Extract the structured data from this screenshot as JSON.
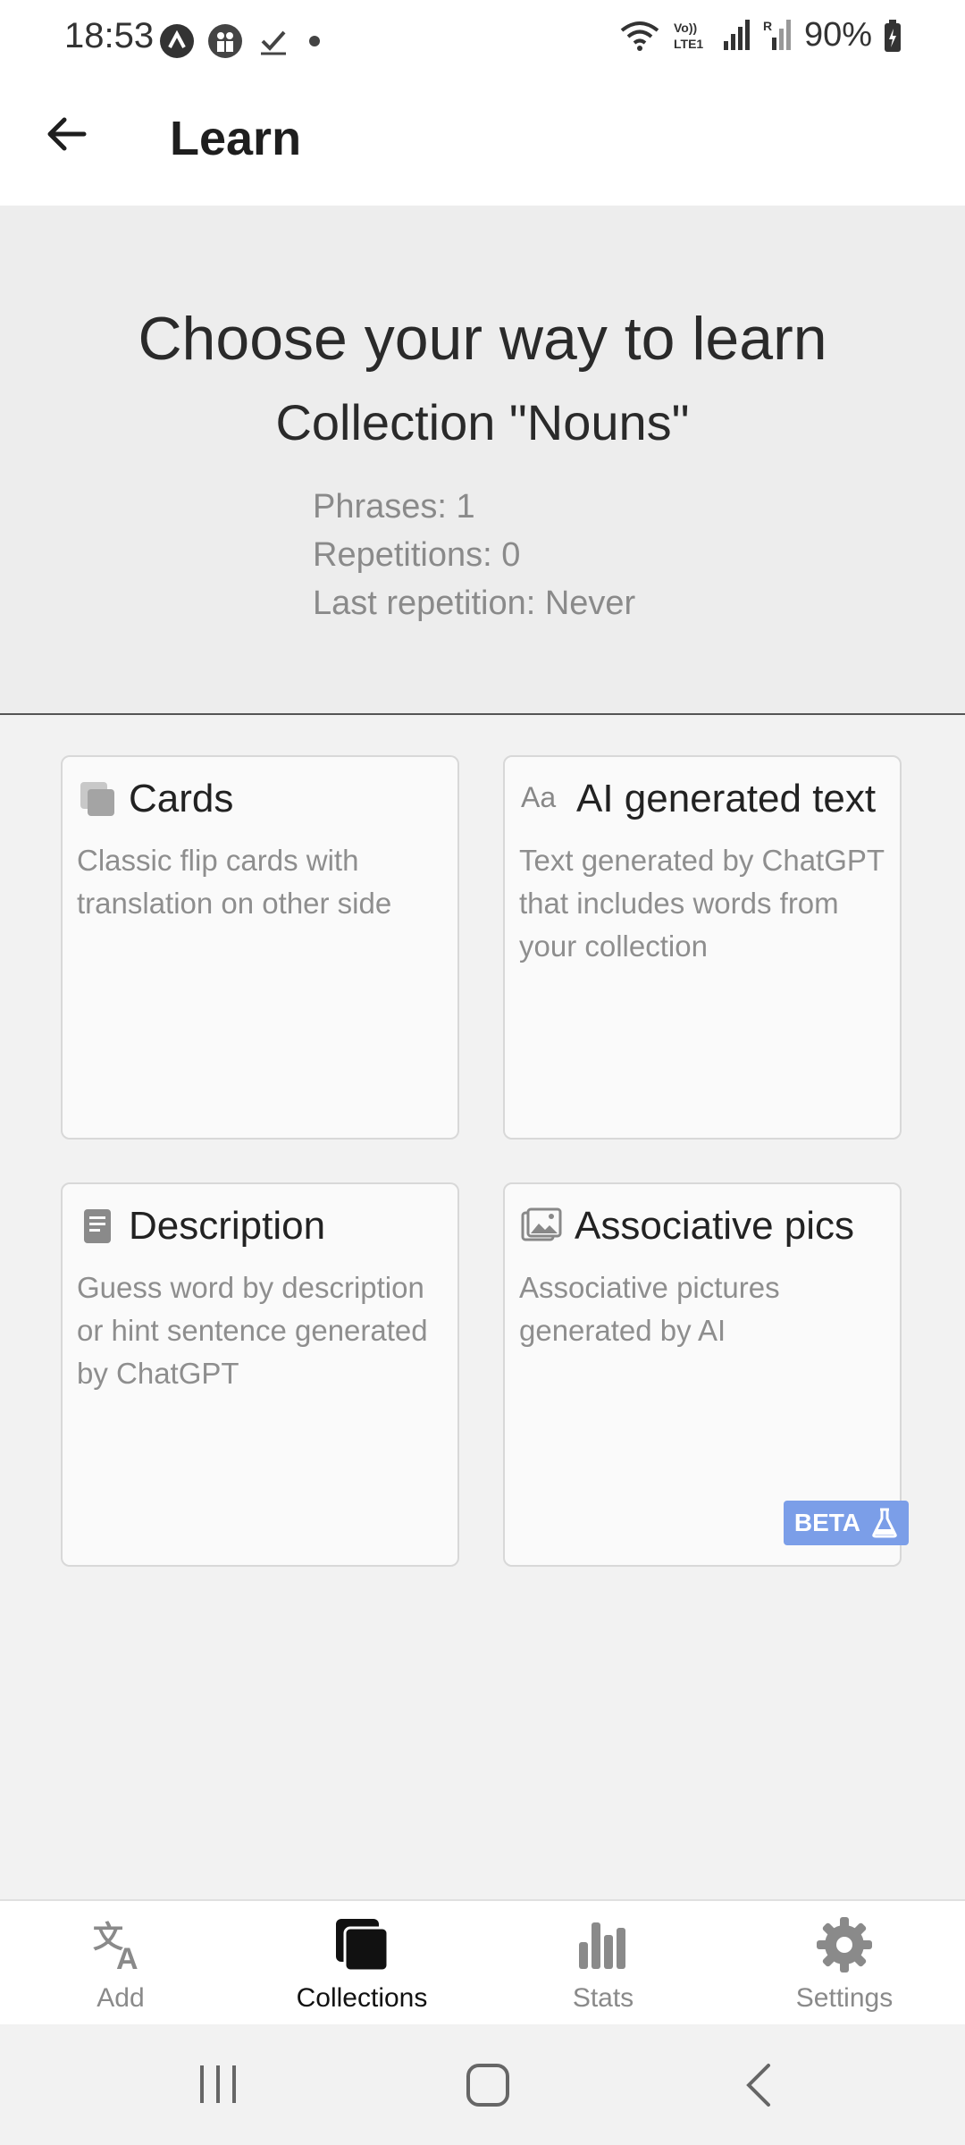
{
  "status": {
    "time": "18:53",
    "battery": "90%",
    "icons": [
      "app-a-icon",
      "users-icon",
      "check-icon",
      "dot-icon",
      "wifi-icon",
      "volte-icon",
      "signal-icon",
      "roaming-signal-icon",
      "battery-icon"
    ]
  },
  "header": {
    "title": "Learn"
  },
  "hero": {
    "title": "Choose your way to learn",
    "collection": "Collection \"Nouns\"",
    "phrases": "Phrases: 1",
    "repetitions": "Repetitions: 0",
    "last_repetition": "Last repetition: Never"
  },
  "cards": [
    {
      "title": "Cards",
      "description": "Classic flip cards with translation on other side",
      "icon": "cards-icon"
    },
    {
      "title": "AI generated text",
      "description": "Text generated by ChatGPT that includes words from your collection",
      "icon": "text-aa-icon"
    },
    {
      "title": "Description",
      "description": "Guess word by description or hint sentence generated by ChatGPT",
      "icon": "document-icon"
    },
    {
      "title": "Associative pics",
      "description": "Associative pictures generated by AI",
      "icon": "image-icon",
      "badge": "BETA"
    }
  ],
  "nav": [
    {
      "label": "Add",
      "icon": "translate-icon",
      "active": false
    },
    {
      "label": "Collections",
      "icon": "collections-icon",
      "active": true
    },
    {
      "label": "Stats",
      "icon": "stats-icon",
      "active": false
    },
    {
      "label": "Settings",
      "icon": "gear-icon",
      "active": false
    }
  ],
  "colors": {
    "accent_badge": "#7b9ee8",
    "hero_bg": "#ededed",
    "card_bg": "#fafafa"
  }
}
